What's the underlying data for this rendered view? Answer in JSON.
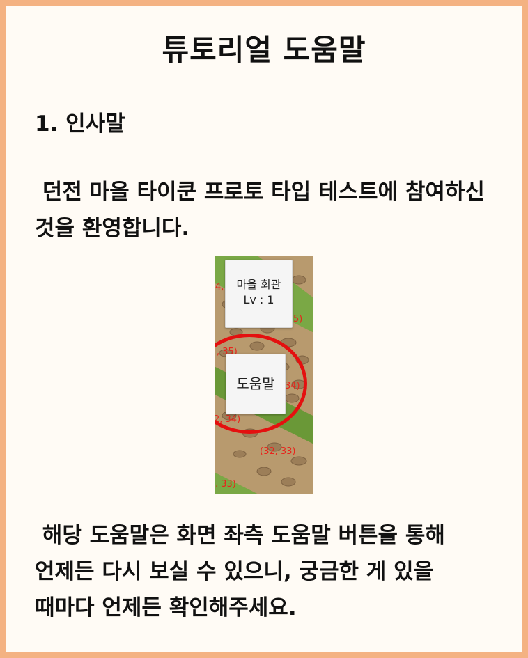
{
  "title": "튜토리얼 도움말",
  "section": {
    "heading": "1. 인사말",
    "paragraph1": " 던전 마을 타이쿤 프로토 타입 테스트에 참여하신 것을 환영합니다.",
    "paragraph2": " 해당 도움말은 화면 좌측 도움말 버튼을 통해 언제든 다시 보실 수 있으니, 궁금한 게 있을 때마다 언제든 확인해주세요."
  },
  "preview": {
    "hall_button": {
      "name": "마을 회관",
      "level": "Lv : 1"
    },
    "help_button_label": "도움말",
    "coords": {
      "c1": "4,",
      "c2": "5)",
      "c3": ", 35)",
      "c4": "34)",
      "c5": "2, 34)",
      "c6": "(32, 33)",
      "c7": ". 33)"
    },
    "colors": {
      "grass": "#6f9a3a",
      "path": "#b89a6e",
      "highlight_circle": "#e4100f",
      "coord_text": "#e8241b"
    }
  },
  "colors": {
    "border": "#f4b282",
    "background": "#fffbf5",
    "text": "#111111"
  }
}
